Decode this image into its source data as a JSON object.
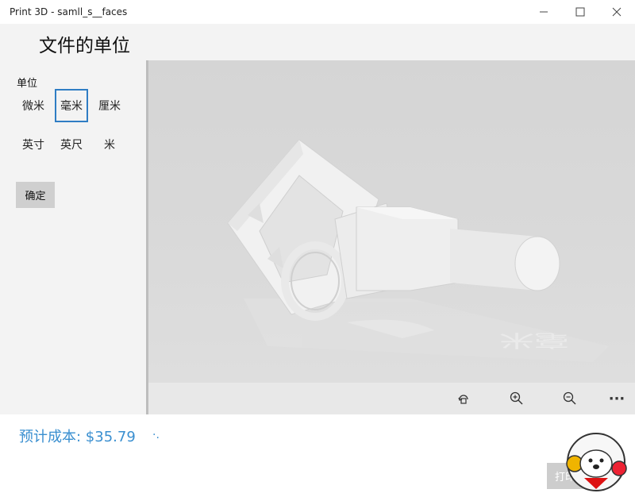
{
  "window": {
    "title": "Print 3D - samll_s__faces",
    "controls": {
      "minimize": "—",
      "maximize": "☐",
      "close": "✕"
    }
  },
  "page": {
    "title": "文件的单位"
  },
  "units": {
    "label": "单位",
    "options": [
      "微米",
      "毫米",
      "厘米",
      "英寸",
      "英尺",
      "米"
    ],
    "selected": "毫米"
  },
  "confirm_label": "确定",
  "viewport": {
    "tools": {
      "rotate": "rotate-view-icon",
      "zoom_in": "zoom-in-icon",
      "zoom_out": "zoom-out-icon",
      "more": "···"
    }
  },
  "footer": {
    "cost": "预计成本: $35.79",
    "loading": "·.",
    "print_label": "打印"
  },
  "colors": {
    "accent": "#2f7dc4",
    "cost_text": "#3a8fd0",
    "panel_bg": "#f3f3f3",
    "viewport_bg": "#d9d9d9"
  }
}
